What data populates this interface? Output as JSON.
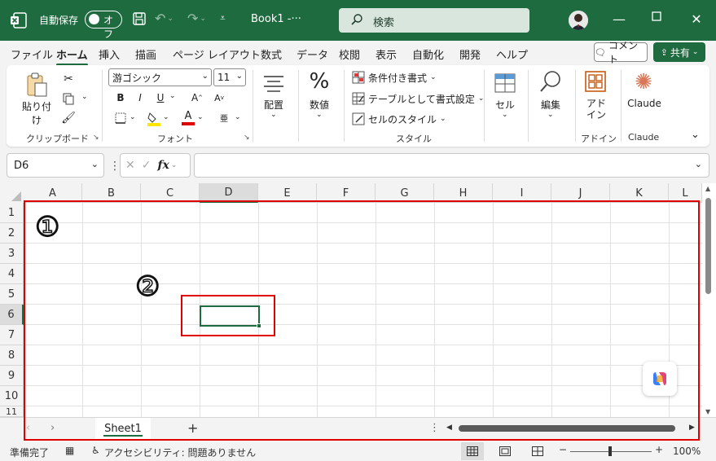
{
  "titlebar": {
    "autosave_label": "自動保存",
    "autosave_state": "オフ",
    "doc_title": "Book1  -···",
    "search_placeholder": "検索"
  },
  "menu": {
    "tabs": [
      "ファイル",
      "ホーム",
      "挿入",
      "描画",
      "ページ レイアウト",
      "数式",
      "データ",
      "校閲",
      "表示",
      "自動化",
      "開発",
      "ヘルプ"
    ],
    "active_tab": "ホーム",
    "comment_label": "コメント",
    "share_label": "共有"
  },
  "ribbon": {
    "paste_label": "貼り付け",
    "clipboard_group": "クリップボード",
    "font_name": "游ゴシック",
    "font_size": "11",
    "font_group": "フォント",
    "align_label": "配置",
    "number_label": "数値",
    "cond_format": "条件付き書式",
    "table_format": "テーブルとして書式設定",
    "cell_style": "セルのスタイル",
    "style_group": "スタイル",
    "cells_label": "セル",
    "edit_label": "編集",
    "addin_label": "アド\nイン",
    "addin_group": "アドイン",
    "claude_label": "Claude",
    "claude_group": "Claude",
    "bold": "B",
    "italic": "I",
    "underline": "U",
    "grow_font": "A",
    "shrink_font": "A",
    "font_color": "A"
  },
  "formula_bar": {
    "name_box": "D6",
    "fx": "fx",
    "formula": ""
  },
  "grid": {
    "columns": [
      "A",
      "B",
      "C",
      "D",
      "E",
      "F",
      "G",
      "H",
      "I",
      "J",
      "K",
      "L"
    ],
    "rows": [
      "1",
      "2",
      "3",
      "4",
      "5",
      "6",
      "7",
      "8",
      "9",
      "10",
      "11"
    ],
    "selected_column": "D",
    "selected_row": "6"
  },
  "sheets": {
    "tabs": [
      "Sheet1"
    ],
    "add": "+"
  },
  "status": {
    "ready": "準備完了",
    "accessibility": "アクセシビリティ: 問題ありません",
    "zoom": "100%",
    "zoom_out": "−",
    "zoom_in": "+"
  },
  "annotations": {
    "marker1": "①",
    "marker2": "②",
    "color": "#e00000"
  },
  "colors": {
    "brand": "#1e6b3f"
  }
}
